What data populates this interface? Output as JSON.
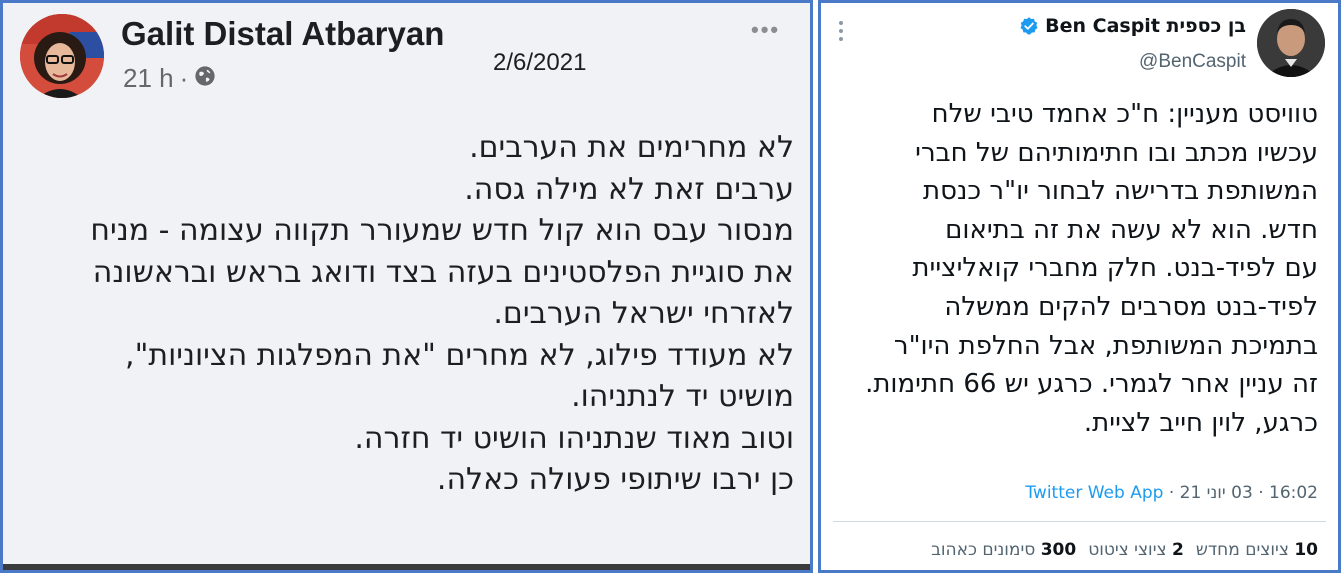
{
  "facebook_post": {
    "author_name": "Galit Distal Atbaryan",
    "time_ago": "21 h",
    "separator": "·",
    "privacy_icon": "globe-icon",
    "more_icon": "ellipsis-icon",
    "more_label": "•••",
    "date_stamp": "2/6/2021",
    "lines": [
      "לא מחרימים את הערבים.",
      "ערבים זאת לא מילה גסה.",
      "מנסור עבס הוא קול חדש שמעורר תקווה עצומה - מניח",
      "את סוגיית הפלסטינים בעזה בצד ודואג בראש ובראשונה",
      "לאזרחי ישראל הערבים.",
      "לא מעודד פילוג, לא מחרים \"את המפלגות הציוניות\",",
      "מושיט יד לנתניהו.",
      "וטוב מאוד שנתניהו הושיט יד חזרה.",
      "כן ירבו שיתופי פעולה כאלה."
    ]
  },
  "tweet": {
    "display_name": "בן כספית Ben Caspit",
    "handle": "@BenCaspit",
    "verified_icon": "verified-badge-icon",
    "menu_icon": "vertical-dots-icon",
    "lines": [
      "טוויסט מעניין: ח\"כ אחמד טיבי שלח",
      "עכשיו מכתב ובו חתימותיהם של חברי",
      "המשותפת בדרישה לבחור יו\"ר כנסת",
      "חדש. הוא לא עשה את זה בתיאום",
      "עם לפיד-בנט. חלק מחברי קואליציית",
      "לפיד-בנט מסרבים להקים ממשלה",
      "בתמיכת המשותפת, אבל החלפת היו\"ר",
      "זה עניין אחר לגמרי. כרגע יש 66 חתימות.",
      "כרגע, לוין חייב לציית."
    ],
    "time": "16:02",
    "date": "03 יוני 21",
    "dot": "·",
    "source": "Twitter Web App",
    "stats": {
      "retweets_count": "10",
      "retweets_label": "ציוצים מחדש",
      "quotes_count": "2",
      "quotes_label": "ציוצי ציטוט",
      "likes_count": "300",
      "likes_label": "סימונים כאהוב"
    },
    "colors": {
      "link_blue": "#1d9bf0",
      "verified_blue": "#1d9bf0"
    }
  },
  "frame_color": "#4a79c7"
}
